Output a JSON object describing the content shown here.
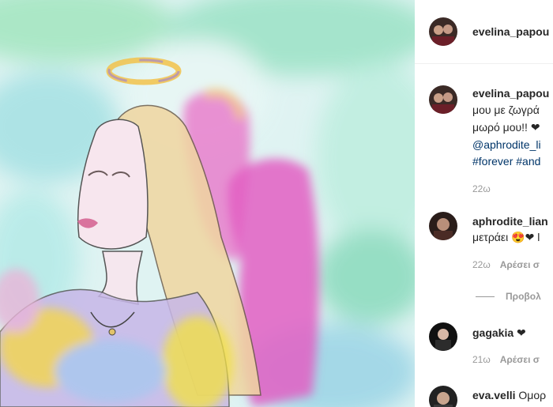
{
  "post": {
    "image_alt": "watercolor angel illustration",
    "author": "evelina_papou"
  },
  "caption": {
    "author": "evelina_papou",
    "lines": [
      "μου με ζωγρά",
      "μωρό μου!! ❤"
    ],
    "mention": "@aphrodite_li",
    "hashtags": "#forever #and",
    "time": "22ω"
  },
  "comments": [
    {
      "user": "aphrodite_lian",
      "text": "μετράει 😍❤ l",
      "time": "22ω",
      "like_label": "Αρέσει σ"
    },
    {
      "user": "gagakia",
      "text": "❤",
      "time": "21ω",
      "like_label": "Αρέσει σ"
    },
    {
      "user": "eva.velli",
      "text": "Ομορ"
    }
  ],
  "replies_label": "Προβολ"
}
